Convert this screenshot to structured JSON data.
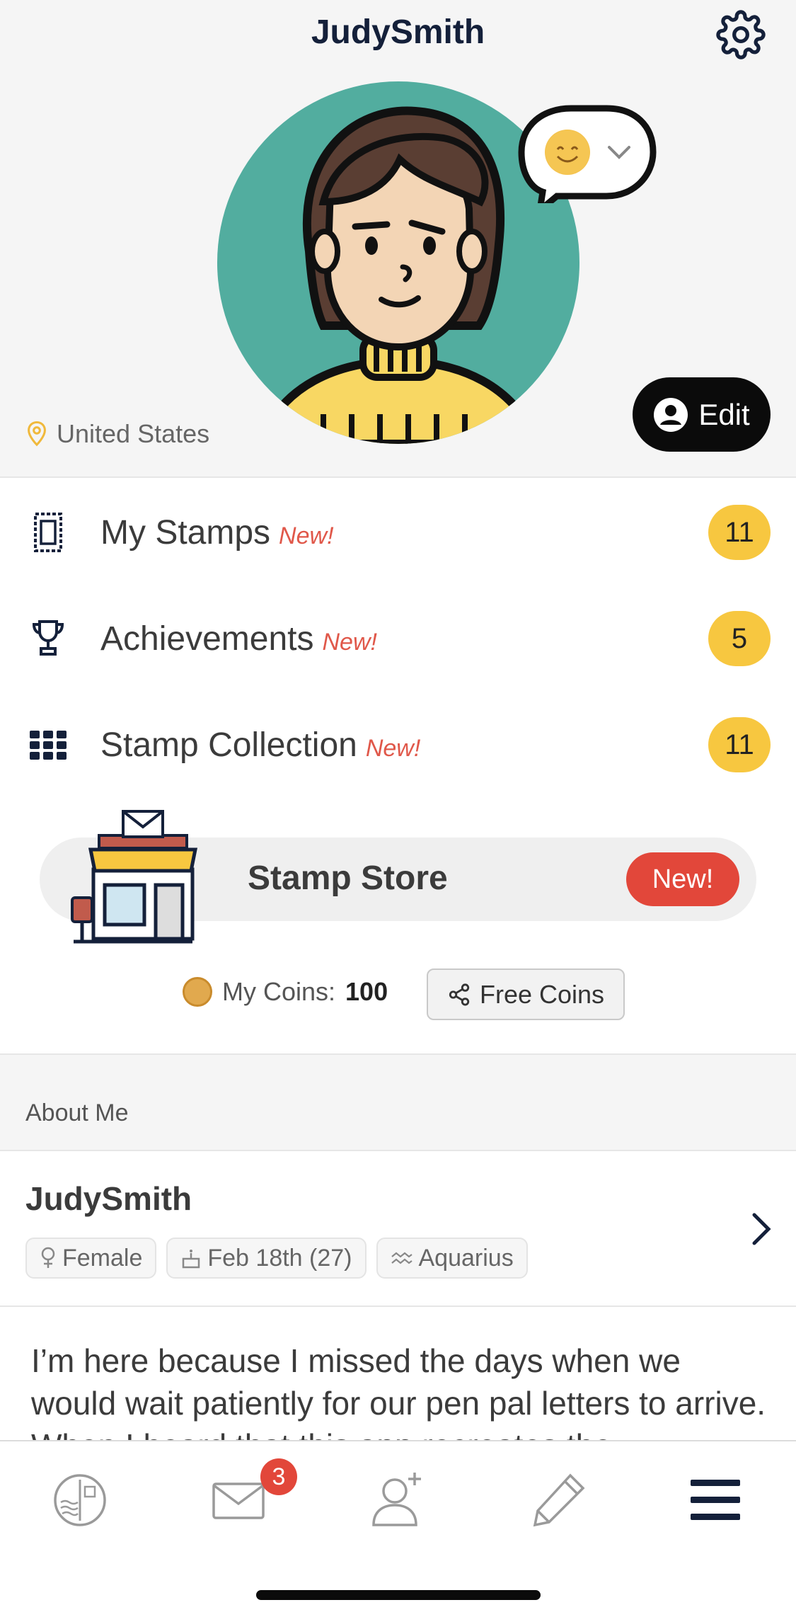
{
  "header": {
    "title": "JudySmith",
    "location": "United States",
    "edit_label": "Edit",
    "mood_icon": "smile-emoji"
  },
  "menu": [
    {
      "label": "My Stamps",
      "new_label": "New!",
      "count": "11",
      "icon": "stamp-icon"
    },
    {
      "label": "Achievements",
      "new_label": "New!",
      "count": "5",
      "icon": "trophy-icon"
    },
    {
      "label": "Stamp Collection",
      "new_label": "New!",
      "count": "11",
      "icon": "grid-icon"
    }
  ],
  "store": {
    "label": "Stamp Store",
    "new_label": "New!"
  },
  "coins": {
    "label": "My Coins:",
    "value": "100",
    "free_label": "Free Coins"
  },
  "about": {
    "heading": "About Me",
    "name": "JudySmith",
    "gender": "Female",
    "birthday": "Feb 18th (27)",
    "zodiac": "Aquarius",
    "bio": "I’m here because I missed the days when we would wait patiently for our pen pal letters to arrive. When I heard that this app recreates the"
  },
  "tabbar": {
    "mail_badge": "3",
    "tabs": [
      "stamp-tab-icon",
      "mail-icon",
      "add-friend-icon",
      "pencil-icon",
      "menu-icon"
    ]
  },
  "colors": {
    "accent_yellow": "#f7c740",
    "new_red": "#e0584a",
    "avatar_teal": "#52ad9f",
    "navy": "#14203a"
  }
}
